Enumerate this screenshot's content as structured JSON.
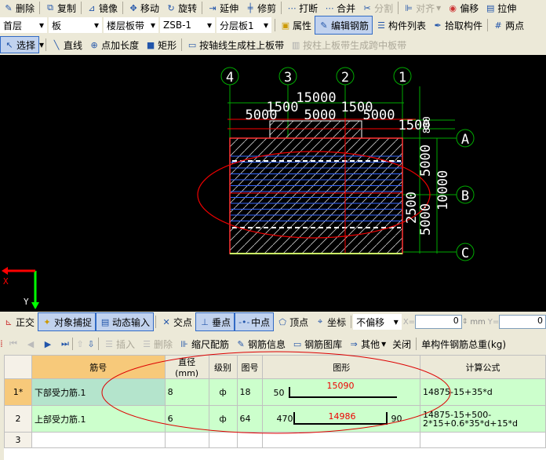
{
  "toolbar1": [
    "删除",
    "复制",
    "镜像",
    "移动",
    "旋转",
    "延伸",
    "修剪",
    "打断",
    "合并",
    "分割",
    "对齐",
    "偏移",
    "拉伸"
  ],
  "toolbar2": {
    "floor": "首层",
    "type": "板",
    "sub": "楼层板带",
    "name": "ZSB-1",
    "layer": "分层板1",
    "buttons": [
      "属性",
      "编辑钢筋",
      "构件列表",
      "拾取构件",
      "两点"
    ]
  },
  "toolbar3": [
    "选择",
    "直线",
    "点加长度",
    "矩形",
    "按轴线生成柱上板带",
    "按柱上板带生成跨中板带"
  ],
  "canvas": {
    "axes_x": [
      "4",
      "3",
      "2",
      "1"
    ],
    "axes_y": [
      "A",
      "B",
      "C"
    ],
    "dims": {
      "total": "15000",
      "spans": [
        "5000",
        "5000",
        "5000"
      ],
      "col": [
        "1500",
        "1500"
      ],
      "side": [
        "1500",
        "800",
        "5000",
        "10000",
        "2500",
        "5000"
      ]
    },
    "coord": {
      "x": "X",
      "y": "Y"
    }
  },
  "snapbar": {
    "items": [
      "正交",
      "对象捕捉",
      "动态输入",
      "交点",
      "垂点",
      "中点",
      "顶点",
      "坐标"
    ],
    "offset": "不偏移",
    "x_label": "X=",
    "x_val": "0",
    "unit": "mm",
    "y_label": "Y=",
    "y_val": "0"
  },
  "gridbar": [
    "插入",
    "删除",
    "缩尺配筋",
    "钢筋信息",
    "钢筋图库",
    "其他",
    "关闭",
    "单构件钢筋总重(kg)"
  ],
  "table": {
    "headers": [
      "筋号",
      "直径(mm)",
      "级别",
      "图号",
      "图形",
      "计算公式"
    ],
    "rows": [
      {
        "n": "1*",
        "name": "下部受力筋.1",
        "d": "8",
        "grade": "ф",
        "fig": "18",
        "left": "50",
        "len": "15090",
        "right": "",
        "formula": "14875-15+35*d"
      },
      {
        "n": "2",
        "name": "上部受力筋.1",
        "d": "6",
        "grade": "ф",
        "fig": "64",
        "left": "470",
        "len": "14986",
        "right": "90",
        "formula": "14875-15+500-2*15+0.6*35*d+15*d"
      },
      {
        "n": "3",
        "name": "",
        "d": "",
        "grade": "",
        "fig": "",
        "left": "",
        "len": "",
        "right": "",
        "formula": ""
      }
    ]
  },
  "colors": {
    "annotation": "#ff0000",
    "canvas": "#000000",
    "row": "#ccffcc"
  }
}
